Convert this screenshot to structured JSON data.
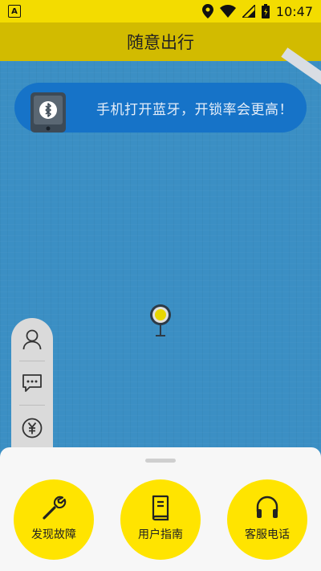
{
  "status_bar": {
    "app_badge": "A",
    "time": "10:47",
    "icons": [
      "location-icon",
      "wifi-icon",
      "signal-icon",
      "battery-icon"
    ]
  },
  "header": {
    "title": "随意出行"
  },
  "banner": {
    "text": "手机打开蓝牙，开锁率会更高！",
    "icon": "bluetooth-phone-icon"
  },
  "side_menu": {
    "items": [
      {
        "icon": "user-icon"
      },
      {
        "icon": "message-icon"
      },
      {
        "icon": "yuan-icon"
      }
    ]
  },
  "bottom_actions": [
    {
      "label": "发现故障",
      "icon": "wrench-icon"
    },
    {
      "label": "用户指南",
      "icon": "book-icon"
    },
    {
      "label": "客服电话",
      "icon": "headphones-icon"
    }
  ],
  "colors": {
    "accent_yellow": "#ffe400",
    "header_yellow": "#d2bb00",
    "map_blue": "#3b8fc4",
    "banner_blue": "#1673c8"
  }
}
